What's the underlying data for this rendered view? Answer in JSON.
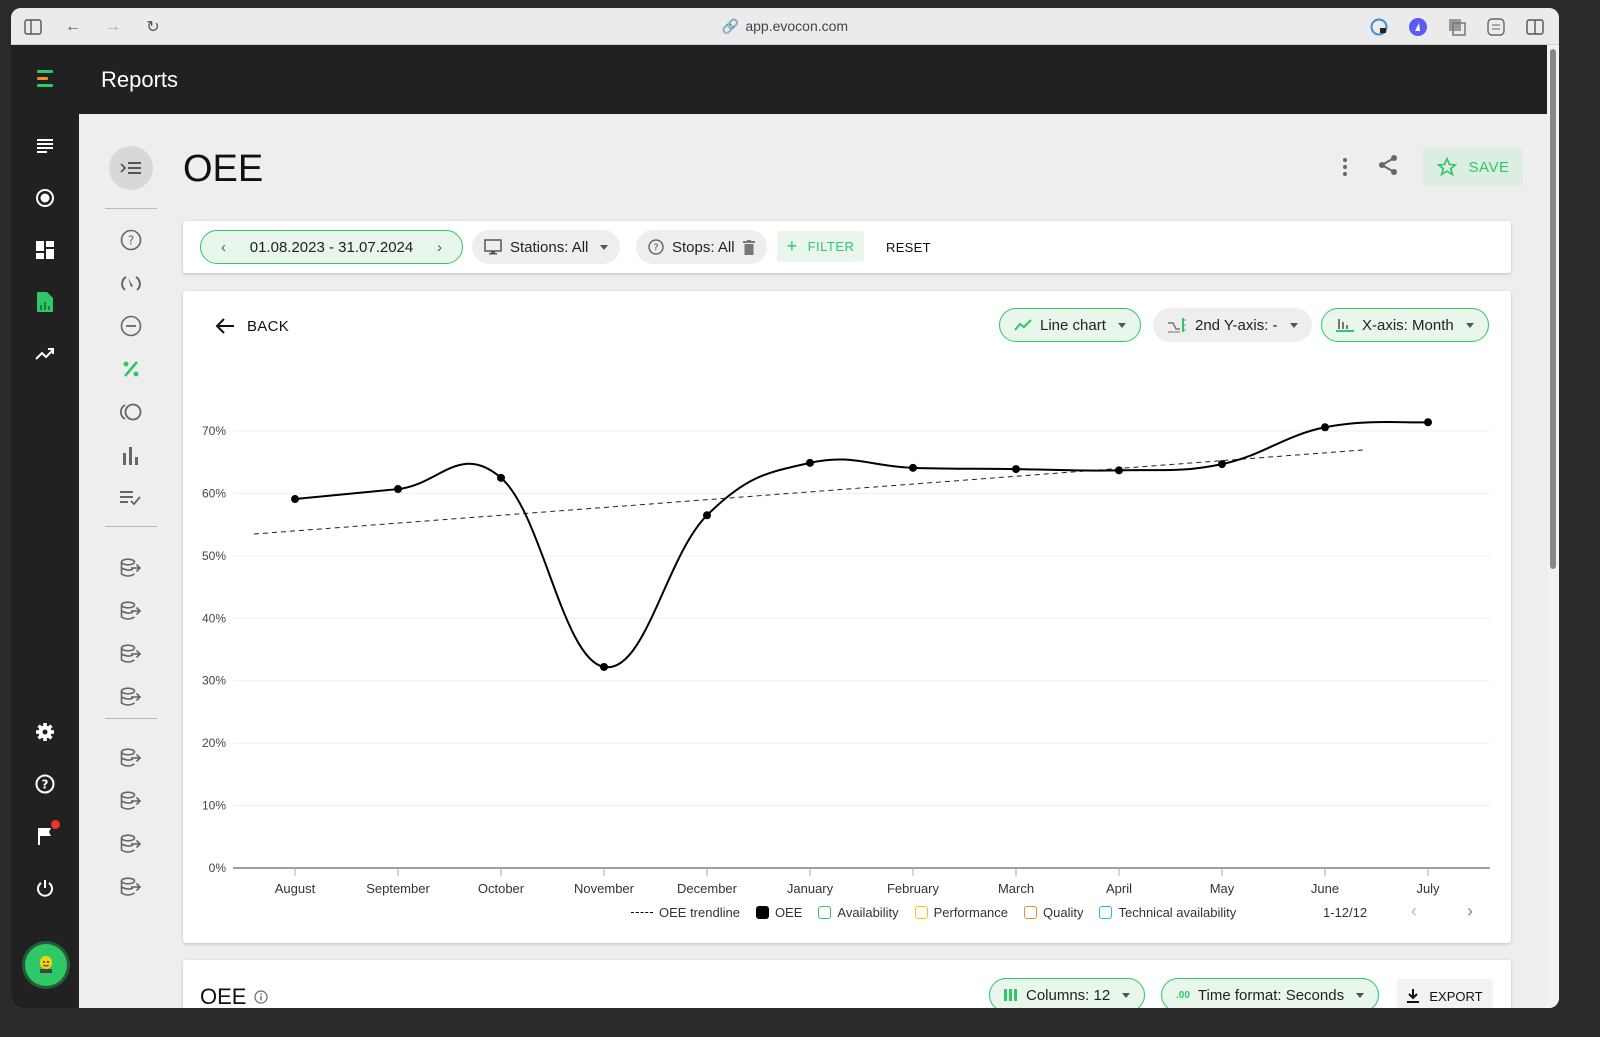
{
  "browser": {
    "url": "app.evocon.com",
    "icons": [
      "sidebar-toggle-icon",
      "back-arrow-icon",
      "forward-arrow-icon",
      "reload-icon",
      "password-lock-icon",
      "extension-icon",
      "tabs-overview-icon",
      "settings-sliders-icon",
      "split-view-icon"
    ]
  },
  "app": {
    "header_title": "Reports",
    "brand_colors": {
      "primary": "#2ec866",
      "accent": "#f28c28",
      "dark": "#212121"
    }
  },
  "leftnav": {
    "items": [
      {
        "name": "list",
        "icon": "list-icon",
        "active": false
      },
      {
        "name": "monitoring",
        "icon": "target-circle-icon",
        "active": false
      },
      {
        "name": "dashboard",
        "icon": "dashboard-icon",
        "active": false
      },
      {
        "name": "reports",
        "icon": "report-chart-icon",
        "active": true
      },
      {
        "name": "trends",
        "icon": "trending-up-icon",
        "active": false
      }
    ],
    "bottom": [
      {
        "name": "settings",
        "icon": "gear-icon"
      },
      {
        "name": "help",
        "icon": "help-circle-icon"
      },
      {
        "name": "notifications",
        "icon": "flag-icon",
        "badge": true
      },
      {
        "name": "logout",
        "icon": "power-icon"
      }
    ]
  },
  "subnav": {
    "collapse_icon": "menu-collapse-icon",
    "group1": [
      "help-circle-icon",
      "gauge-icon",
      "minus-circle-icon",
      "percent-icon",
      "circles-icon",
      "bar-chart-icon",
      "checklist-icon"
    ],
    "active": "percent-icon",
    "group2_count": 4,
    "group3_count": 4
  },
  "page": {
    "title": "OEE",
    "save_label": "SAVE"
  },
  "filters": {
    "date_range": "01.08.2023 - 31.07.2024",
    "stations": "Stations: All",
    "stops": "Stops: All",
    "filter_label": "FILTER",
    "reset_label": "RESET"
  },
  "chart_controls": {
    "back_label": "BACK",
    "chart_type": "Line chart",
    "second_y_axis": "2nd Y-axis: -",
    "x_axis": "X-axis: Month"
  },
  "chart_data": {
    "type": "line",
    "title": "OEE",
    "xlabel": "",
    "ylabel": "",
    "categories": [
      "August",
      "September",
      "October",
      "November",
      "December",
      "January",
      "February",
      "March",
      "April",
      "May",
      "June",
      "July"
    ],
    "series": [
      {
        "name": "OEE",
        "values": [
          59.1,
          60.7,
          62.5,
          32.2,
          56.5,
          64.9,
          64.1,
          63.9,
          63.7,
          64.7,
          70.6,
          71.4
        ],
        "color": "#000000",
        "smooth": true
      }
    ],
    "trendline": {
      "name": "OEE trendline",
      "start": 53.5,
      "end": 67.0,
      "style": "dashed"
    },
    "ylim": [
      0,
      70
    ],
    "yticks": [
      0,
      10,
      20,
      30,
      40,
      50,
      60,
      70
    ],
    "ytick_labels": [
      "0%",
      "10%",
      "20%",
      "30%",
      "40%",
      "50%",
      "60%",
      "70%"
    ],
    "grid": true,
    "legend": [
      {
        "label": "OEE trendline",
        "type": "dashed",
        "color": "#000000"
      },
      {
        "label": "OEE",
        "type": "filled",
        "color": "#000000"
      },
      {
        "label": "Availability",
        "type": "outline",
        "color": "#2ec866"
      },
      {
        "label": "Performance",
        "type": "outline",
        "color": "#f5c518"
      },
      {
        "label": "Quality",
        "type": "outline",
        "color": "#f28c28"
      },
      {
        "label": "Technical availability",
        "type": "outline",
        "color": "#29b6e0"
      }
    ],
    "legend_position": "bottom",
    "pagination": "1-12/12"
  },
  "table_section": {
    "title": "OEE",
    "columns_label": "Columns: 12",
    "time_format_label": "Time format: Seconds",
    "export_label": "EXPORT"
  }
}
